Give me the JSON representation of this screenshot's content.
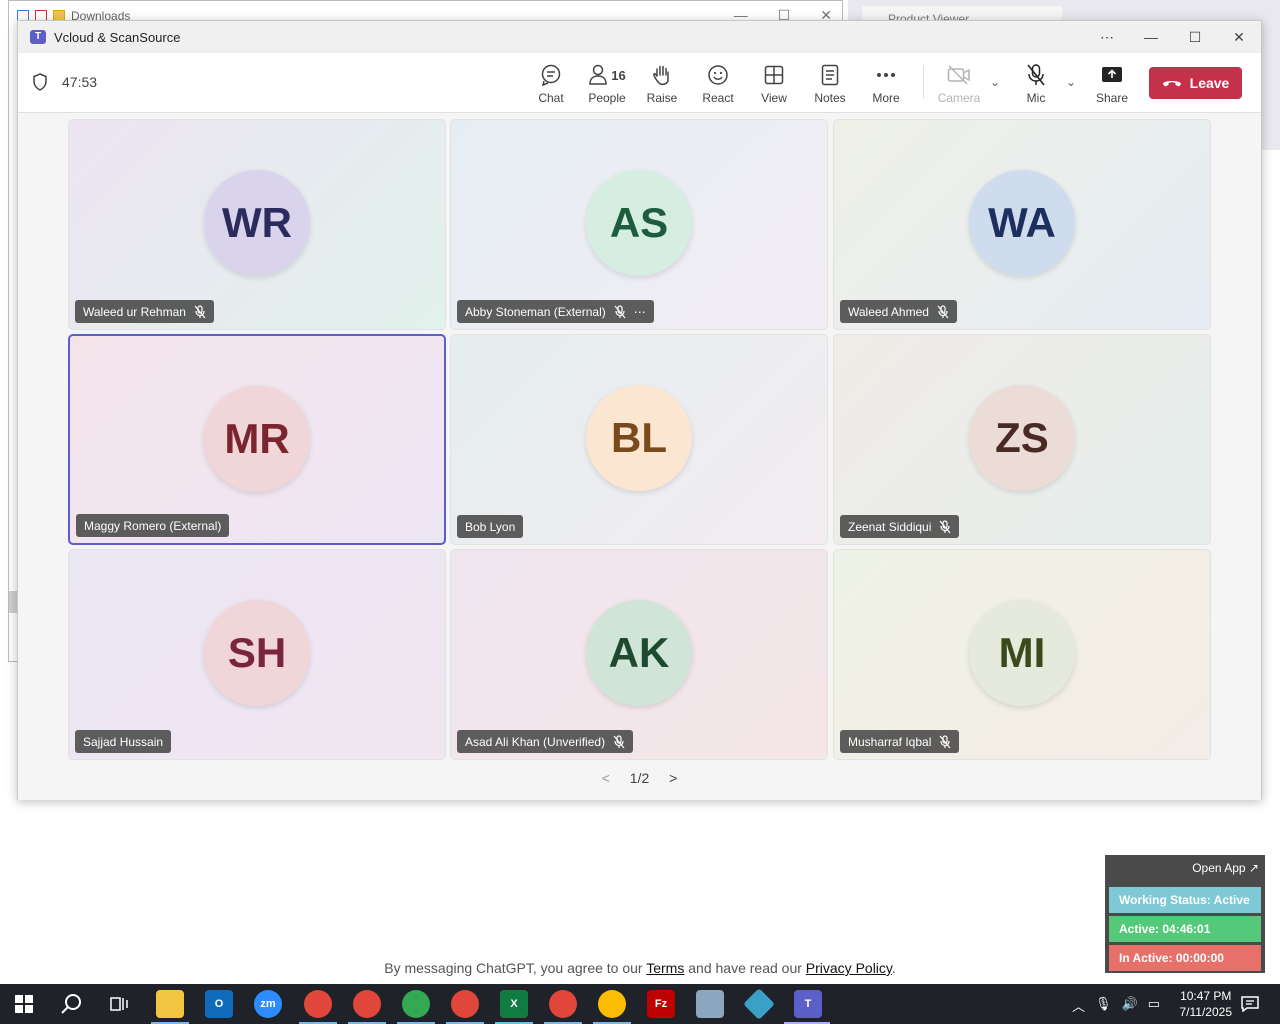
{
  "background": {
    "explorer_title": "Downloads",
    "browser_tab": "Product Viewer"
  },
  "window": {
    "title": "Vcloud & ScanSource"
  },
  "toolbar": {
    "timer": "47:53",
    "chat": "Chat",
    "people": "People",
    "people_count": "16",
    "raise": "Raise",
    "react": "React",
    "view": "View",
    "notes": "Notes",
    "more": "More",
    "camera": "Camera",
    "mic": "Mic",
    "share": "Share",
    "leave": "Leave"
  },
  "participants": [
    {
      "initials": "WR",
      "name": "Waleed ur Rehman",
      "muted": true,
      "bg": "linear-gradient(135deg,#ece4f2,#e2f2ec)",
      "avatar_bg": "#d9d4ec",
      "avatar_fg": "#2b2b5e"
    },
    {
      "initials": "AS",
      "name": "Abby Stoneman (External)",
      "muted": true,
      "more": true,
      "bg": "linear-gradient(135deg,#e6eef4,#f2ecf4)",
      "avatar_bg": "#d6eee2",
      "avatar_fg": "#1d5c3d"
    },
    {
      "initials": "WA",
      "name": "Waleed Ahmed",
      "muted": true,
      "bg": "linear-gradient(135deg,#eef0e6,#e6ecf4)",
      "avatar_bg": "#cfdcee",
      "avatar_fg": "#1d2f5e"
    },
    {
      "initials": "MR",
      "name": "Maggy Romero (External)",
      "muted": false,
      "active": true,
      "bg": "linear-gradient(135deg,#f4e4ea,#ede6f4)",
      "avatar_bg": "#f0d6d8",
      "avatar_fg": "#7a2530"
    },
    {
      "initials": "BL",
      "name": "Bob Lyon",
      "muted": false,
      "bg": "linear-gradient(135deg,#e6eef0,#f2ecf0)",
      "avatar_bg": "#fbe6d2",
      "avatar_fg": "#7a4a1c"
    },
    {
      "initials": "ZS",
      "name": "Zeenat Siddiqui",
      "muted": true,
      "bg": "linear-gradient(135deg,#f0ece8,#e6eeec)",
      "avatar_bg": "#ecdcd8",
      "avatar_fg": "#4a2a24"
    },
    {
      "initials": "SH",
      "name": "Sajjad Hussain",
      "muted": false,
      "bg": "linear-gradient(135deg,#ebe6f4,#f0e6f0)",
      "avatar_bg": "#f0d6d8",
      "avatar_fg": "#7a2540"
    },
    {
      "initials": "AK",
      "name": "Asad Ali Khan (Unverified)",
      "muted": true,
      "bg": "linear-gradient(135deg,#f0e6f0,#f4e6e6)",
      "avatar_bg": "#d0e4d8",
      "avatar_fg": "#1d4a2f"
    },
    {
      "initials": "MI",
      "name": "Musharraf Iqbal",
      "muted": true,
      "bg": "linear-gradient(135deg,#eef2e6,#f4ece6)",
      "avatar_bg": "#e6eadc",
      "avatar_fg": "#3a4a1d"
    }
  ],
  "pager": {
    "label": "1/2"
  },
  "consent": {
    "prefix": "By messaging ChatGPT, you agree to our",
    "terms": "Terms",
    "middle": "and have read our",
    "privacy": "Privacy Policy",
    "suffix": "."
  },
  "widget": {
    "open_app": "Open App ↗",
    "working_status": "Working Status: Active",
    "active": "Active: 04:46:01",
    "inactive": "In Active: 00:00:00",
    "colors": {
      "status": "#7fc8d6",
      "active": "#55c97a",
      "inactive": "#e8706a"
    }
  },
  "taskbar": {
    "time": "10:47 PM",
    "date": "7/11/2025"
  }
}
